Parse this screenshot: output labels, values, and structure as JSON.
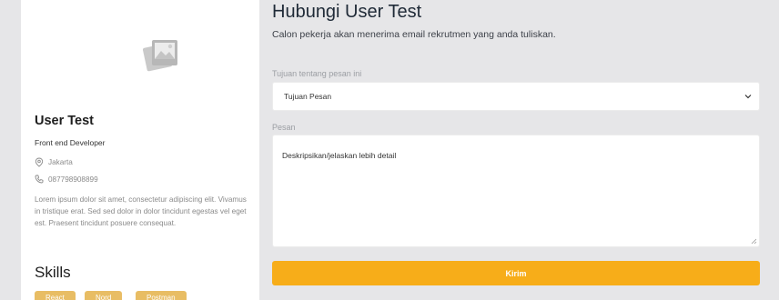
{
  "profile": {
    "name": "User Test",
    "role": "Front end Developer",
    "location": "Jakarta",
    "phone": "087798908899",
    "about": "Lorem ipsum dolor sit amet, consectetur adipiscing elit. Vivamus in tristique erat. Sed sed dolor in dolor tincidunt egestas vel eget est. Praesent tincidunt posuere consequat.",
    "photo_icon": "image-placeholder-icon",
    "skills_title": "Skills",
    "skills": [
      "React",
      "Nord",
      "Postman"
    ]
  },
  "form": {
    "title": "Hubungi User Test",
    "subtitle": "Calon pekerja akan menerima email rekrutmen yang anda tuliskan.",
    "purpose_label": "Tujuan tentang pesan ini",
    "purpose_value": "Tujuan Pesan",
    "message_label": "Pesan",
    "message_placeholder": "Deskripsikan/jelaskan lebih detail",
    "submit_label": "Kirim"
  },
  "colors": {
    "accent": "#f7ad19",
    "badge": "#e5b24a",
    "background": "#e6e6e8"
  }
}
